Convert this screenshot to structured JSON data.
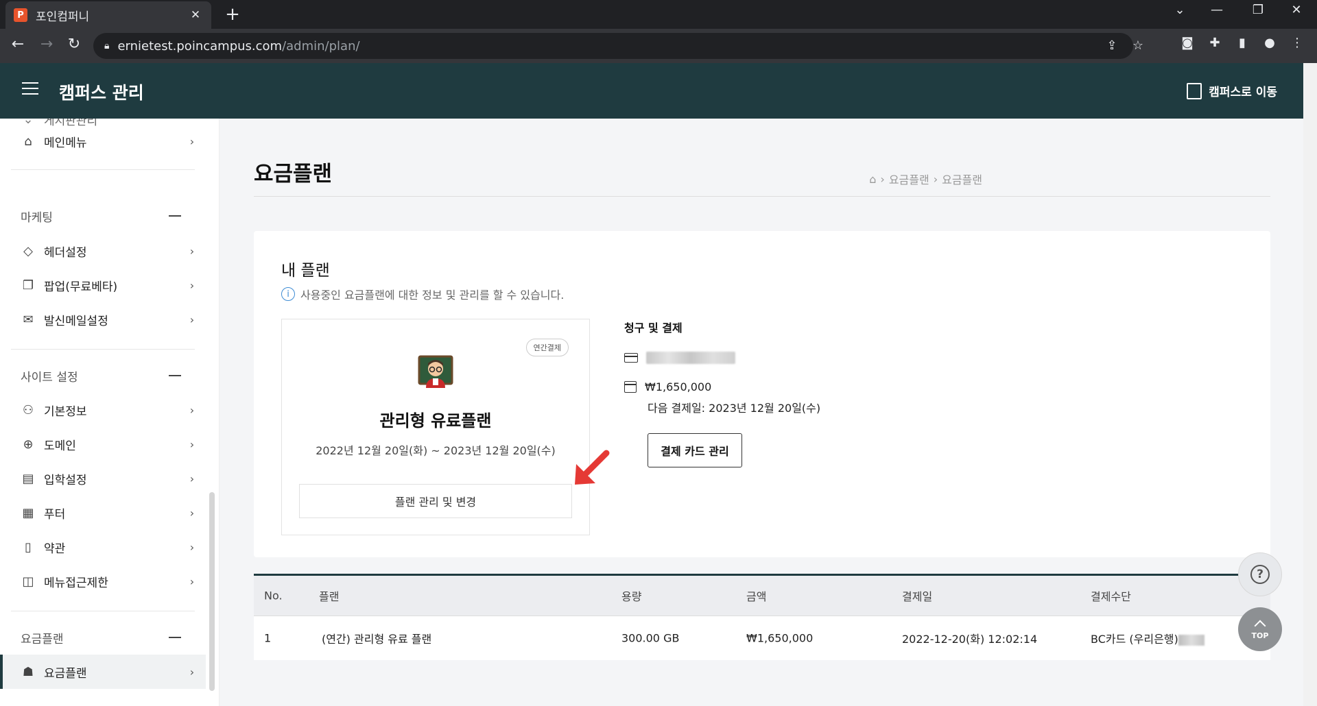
{
  "browser": {
    "tab_title": "포인컴퍼니",
    "favicon_letter": "P",
    "url_host": "ernietest.poincampus.com",
    "url_path": "/admin/plan/"
  },
  "header": {
    "app_title": "캠퍼스 관리",
    "goto_campus": "캠퍼스로 이동",
    "bg_color": "#1f3b40"
  },
  "sidebar": {
    "top_partial": "게시판관리",
    "items_top": [
      {
        "label": "메인메뉴",
        "icon": "tag-icon"
      }
    ],
    "groups": [
      {
        "label": "마케팅",
        "items": [
          {
            "label": "헤더설정",
            "icon": "tags-icon"
          },
          {
            "label": "팝업(무료베타)",
            "icon": "copy-icon"
          },
          {
            "label": "발신메일설정",
            "icon": "mail-icon"
          }
        ]
      },
      {
        "label": "사이트 설정",
        "items": [
          {
            "label": "기본정보",
            "icon": "users-icon"
          },
          {
            "label": "도메인",
            "icon": "globe-icon"
          },
          {
            "label": "입학설정",
            "icon": "document-icon"
          },
          {
            "label": "푸터",
            "icon": "grid-icon"
          },
          {
            "label": "약관",
            "icon": "file-text-icon"
          },
          {
            "label": "메뉴접근제한",
            "icon": "window-lock-icon"
          }
        ]
      },
      {
        "label": "요금플랜",
        "items": [
          {
            "label": "요금플랜",
            "icon": "user-plan-icon",
            "active": true
          }
        ]
      }
    ]
  },
  "page": {
    "title": "요금플랜",
    "breadcrumb": [
      "요금플랜",
      "요금플랜"
    ]
  },
  "plan_panel": {
    "title": "내 플랜",
    "description": "사용중인 요금플랜에 대한 정보 및 관리를 할 수 있습니다.",
    "card": {
      "badge": "연간결제",
      "name": "관리형 유료플랜",
      "period": "2022년 12월 20일(화) ~ 2023년 12월 20일(수)",
      "manage_button": "플랜 관리 및 변경"
    },
    "billing": {
      "title": "청구 및 결제",
      "amount": "₩1,650,000",
      "next_payment": "다음 결제일: 2023년 12월 20일(수)",
      "card_button": "결제 카드 관리"
    }
  },
  "history": {
    "columns": [
      "No.",
      "플랜",
      "용량",
      "금액",
      "결제일",
      "결제수단"
    ],
    "rows": [
      {
        "no": "1",
        "plan": "(연간) 관리형 유료 플랜",
        "storage": "300.00 GB",
        "amount": "₩1,650,000",
        "date": "2022-12-20(화) 12:02:14",
        "method": "BC카드 (우리은행)"
      }
    ]
  },
  "floating": {
    "help": "?",
    "top": "TOP"
  }
}
